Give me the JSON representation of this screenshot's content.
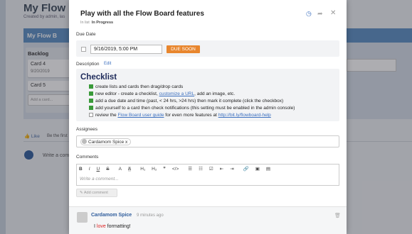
{
  "background": {
    "board_title": "My Flow B",
    "subtitle": "Created by admin, las",
    "board_bar_label": "My Flow B",
    "list_title": "Backlog",
    "cards": [
      {
        "title": "Card 4",
        "date": "9/20/2019"
      },
      {
        "title": "Card 5",
        "date": ""
      }
    ],
    "add_card_placeholder": "Add a card...",
    "like_label": "Like",
    "be_first": "Be the first",
    "write_comment": "Write a comm"
  },
  "modal": {
    "title": "Play with all the Flow Board features",
    "meta_in": "In list",
    "status": "In Progress",
    "icons": {
      "clock": "clock-icon",
      "share": "share-icon",
      "close": "close-icon"
    },
    "due_date": {
      "label": "Due Date",
      "value": "9/16/2019, 5:00 PM",
      "badge": "DUE SOON",
      "badge_color": "#e8862e"
    },
    "description": {
      "label": "Description",
      "edit_label": "Edit",
      "checklist_title": "Checklist",
      "items": [
        {
          "done": true,
          "text_parts": [
            "new editor - create a checklist, ",
            "customize a URL",
            ", add an image, etc."
          ],
          "text": "create lists and cards then drag/drop cards"
        },
        {
          "done": true,
          "text": "new editor - create a checklist, customize a URL, add an image, etc."
        },
        {
          "done": true,
          "text": "add a due date and time (past, < 24 hrs, >24 hrs) then mark it complete (click the checkbox)"
        },
        {
          "done": true,
          "text": "add yourself to a card then check notifications (this setting must be enabled in the admin console)"
        },
        {
          "done": false,
          "text": "review the Flow Board user guide for even more features at http://bit.ly/flowboard-help"
        }
      ],
      "item_0": "create lists and cards then drag/drop cards",
      "item_1_a": "new editor - create a checklist, ",
      "item_1_link": "customize a URL",
      "item_1_b": ", add an image, etc.",
      "item_2": "add a due date and time (past, < 24 hrs, >24 hrs) then mark it complete (click the checkbox)",
      "item_3": "add yourself to a card then check notifications (this setting must be enabled in the admin console)",
      "item_4_a": "review the ",
      "item_4_link": "Flow Board user guide",
      "item_4_b": " for even more features at ",
      "item_4_url": "http://bit.ly/flowboard-help"
    },
    "assignees": {
      "label": "Assignees",
      "chip": "Cardamom Spice",
      "chip_remove": "x"
    },
    "comments": {
      "label": "Comments",
      "toolbar": [
        "B",
        "I",
        "U",
        "S",
        "A",
        "A",
        "H1",
        "H2",
        "99",
        "</>",
        "≡",
        "≡",
        "≡",
        "≡",
        "🔗",
        "▣",
        "▤"
      ],
      "placeholder": "Write a comment...",
      "add_button": "Add comment",
      "entry": {
        "author": "Cardamom Spice",
        "time": "9 minutes ago",
        "text_a": "I ",
        "text_red": "love",
        "text_b": " formatting!"
      }
    }
  }
}
